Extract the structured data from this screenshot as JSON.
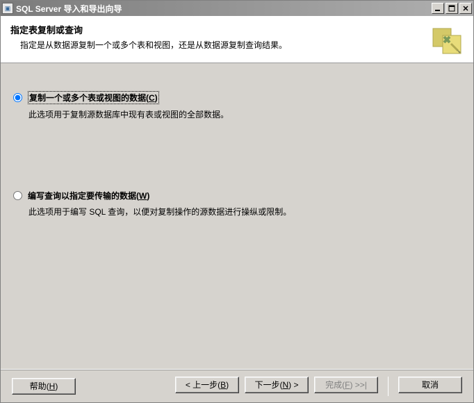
{
  "window": {
    "title": "SQL Server 导入和导出向导"
  },
  "header": {
    "title": "指定表复制或查询",
    "description": "指定是从数据源复制一个或多个表和视图，还是从数据源复制查询结果。"
  },
  "options": {
    "copy": {
      "label_pre": "复制一个或多个表或视图的数据(",
      "accel": "C",
      "label_post": ")",
      "description": "此选项用于复制源数据库中现有表或视图的全部数据。",
      "checked": true
    },
    "query": {
      "label_pre": "编写查询以指定要传输的数据(",
      "accel": "W",
      "label_post": ")",
      "description": "此选项用于编写 SQL 查询，以便对复制操作的源数据进行操纵或限制。",
      "checked": false
    }
  },
  "buttons": {
    "help_pre": "帮助(",
    "help_accel": "H",
    "help_post": ")",
    "back_pre": "< 上一步(",
    "back_accel": "B",
    "back_post": ")",
    "next_pre": "下一步(",
    "next_accel": "N",
    "next_post": ") >",
    "finish_pre": "完成(",
    "finish_accel": "F",
    "finish_post": ") >>|",
    "cancel": "取消"
  }
}
